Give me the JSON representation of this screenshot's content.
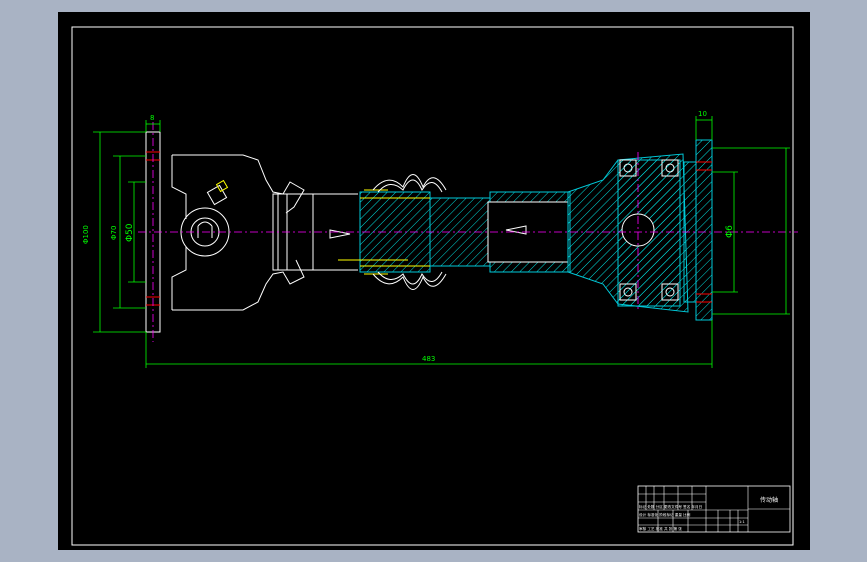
{
  "drawing": {
    "colors": {
      "background": "#000000",
      "workspace": "#a9b3c4",
      "outline": "#ffffff",
      "dimension": "#00ff00",
      "centerline": "#ff00ff",
      "section_cyan": "#00c8d8",
      "hatch": "#00e0e0",
      "highlight": "#ffff00",
      "marks": "#ff0000"
    },
    "dimensions": {
      "left_flange_thickness": "8",
      "right_flange_thickness": "10",
      "left_outer_diameter": "Φ100",
      "left_bolt_circle": "Φ70",
      "left_inner_diameter": "Φ50",
      "right_inner_diameter": "Φ6",
      "overall_length": "483"
    },
    "title_block": {
      "part_name": "传动轴",
      "row1": "",
      "row2": "标记 处数 分区 更改文件号 签名 年月日",
      "row3": "设计 标准化 阶段标记 重量 比例",
      "row4": "审核 工艺 批准 共 张 第 张",
      "scale_value": "1:1"
    }
  }
}
